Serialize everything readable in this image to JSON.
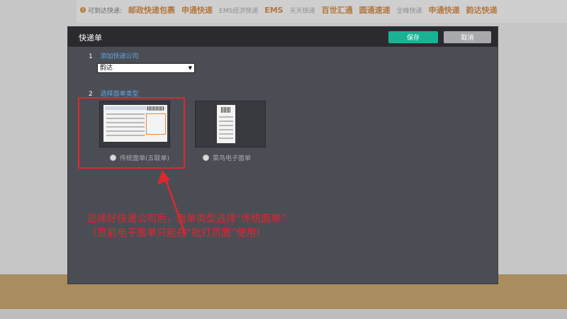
{
  "background": {
    "carriers_label": "可到达快递:",
    "carriers": [
      {
        "name": "邮政快递包裹",
        "style": "hot"
      },
      {
        "name": "申通快递",
        "style": "hot"
      },
      {
        "name": "EMS经济快递",
        "style": "dim"
      },
      {
        "name": "EMS",
        "style": "hot"
      },
      {
        "name": "天天快递",
        "style": "dim"
      },
      {
        "name": "百世汇通",
        "style": "hot"
      },
      {
        "name": "圆通速递",
        "style": "hot"
      },
      {
        "name": "全峰快递",
        "style": "dim"
      },
      {
        "name": "申通快递",
        "style": "hot"
      },
      {
        "name": "韵达快递",
        "style": "hot"
      }
    ]
  },
  "modal": {
    "title": "快递单",
    "save_label": "保存",
    "cancel_label": "取消",
    "step1": {
      "num": "1",
      "label": "添加快递公司"
    },
    "carrier_select": {
      "value": "韵达"
    },
    "step2": {
      "num": "2",
      "label": "选择面单类型"
    },
    "types": [
      {
        "label": "传统面单(五联单)",
        "selected": true
      },
      {
        "label": "菜鸟电子面单",
        "selected": false
      }
    ]
  },
  "annotation": {
    "line1": "选择好快递公司后，面单类型选择“传统面单”",
    "line2": "（目前电子面单只能在“批打页面”使用）"
  },
  "colors": {
    "accent": "#19b394",
    "highlight": "#e1262d",
    "step_label": "#5fa8e0"
  }
}
